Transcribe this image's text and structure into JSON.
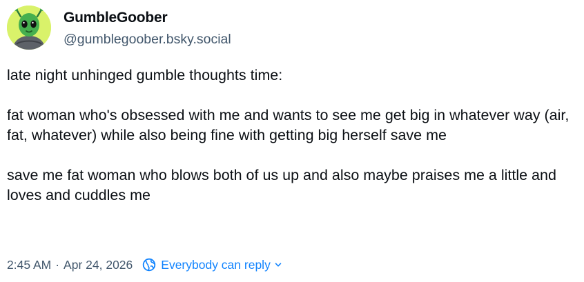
{
  "author": {
    "display_name": "GumbleGoober",
    "handle": "@gumblegoober.bsky.social",
    "avatar_icon": "alien-avatar"
  },
  "post": {
    "paragraphs": [
      "late night unhinged gumble thoughts time:",
      "fat woman who's obsessed with me and wants to see me get big in whatever way (air, fat, whatever) while also being fine with getting big herself save me",
      "save me fat woman who blows both of us up and also maybe praises me a little and loves and cuddles me"
    ]
  },
  "meta": {
    "time": "2:45 AM",
    "separator": "·",
    "date": "Apr 24, 2026",
    "reply_setting": "Everybody can reply",
    "reply_icon": "globe-icon",
    "dropdown_icon": "chevron-down-icon"
  },
  "colors": {
    "text": "#0b0f14",
    "muted": "#42576c",
    "link": "#1083fe",
    "avatar_bg": "#d9f26a"
  }
}
